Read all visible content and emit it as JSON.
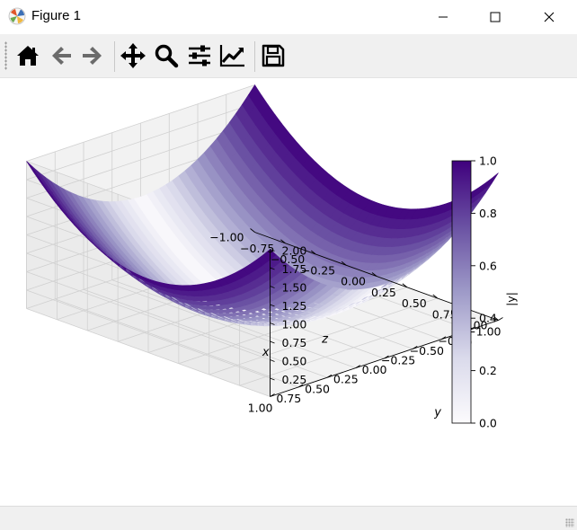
{
  "window": {
    "title": "Figure 1"
  },
  "toolbar": {
    "buttons": [
      "home-icon",
      "back-icon",
      "forward-icon",
      "pan-icon",
      "zoom-icon",
      "configure-subplots-icon",
      "edit-axes-icon",
      "save-icon"
    ]
  },
  "colors": {
    "cmap_low": "#fcfbfd",
    "cmap_mid": "#9e9ac8",
    "cmap_high": "#3f007d"
  },
  "chart_data": {
    "type": "surface3d",
    "function": "z = x^2 + y^2, colored by |y|",
    "x_ticks": [
      "−1.00",
      "−0.75",
      "−0.50",
      "−0.25",
      "0.00",
      "0.25",
      "0.50",
      "0.75",
      "1.00"
    ],
    "y_ticks": [
      "−1.00",
      "−0.75",
      "−0.50",
      "−0.25",
      "0.00",
      "0.25",
      "0.50",
      "0.75",
      "1.00"
    ],
    "z_ticks": [
      "0.25",
      "0.50",
      "0.75",
      "1.00",
      "1.25",
      "1.50",
      "1.75",
      "2.00"
    ],
    "xlabel": "x",
    "ylabel": "y",
    "zlabel": "z",
    "xlim": [
      -1,
      1
    ],
    "ylim": [
      -1,
      1
    ],
    "zlim": [
      0,
      2
    ],
    "colorbar": {
      "label": "|y|",
      "ticks": [
        "0.0",
        "0.2",
        "0.4",
        "0.6",
        "0.8",
        "1.0"
      ],
      "range": [
        0,
        1
      ],
      "cmap": "Purples"
    }
  }
}
